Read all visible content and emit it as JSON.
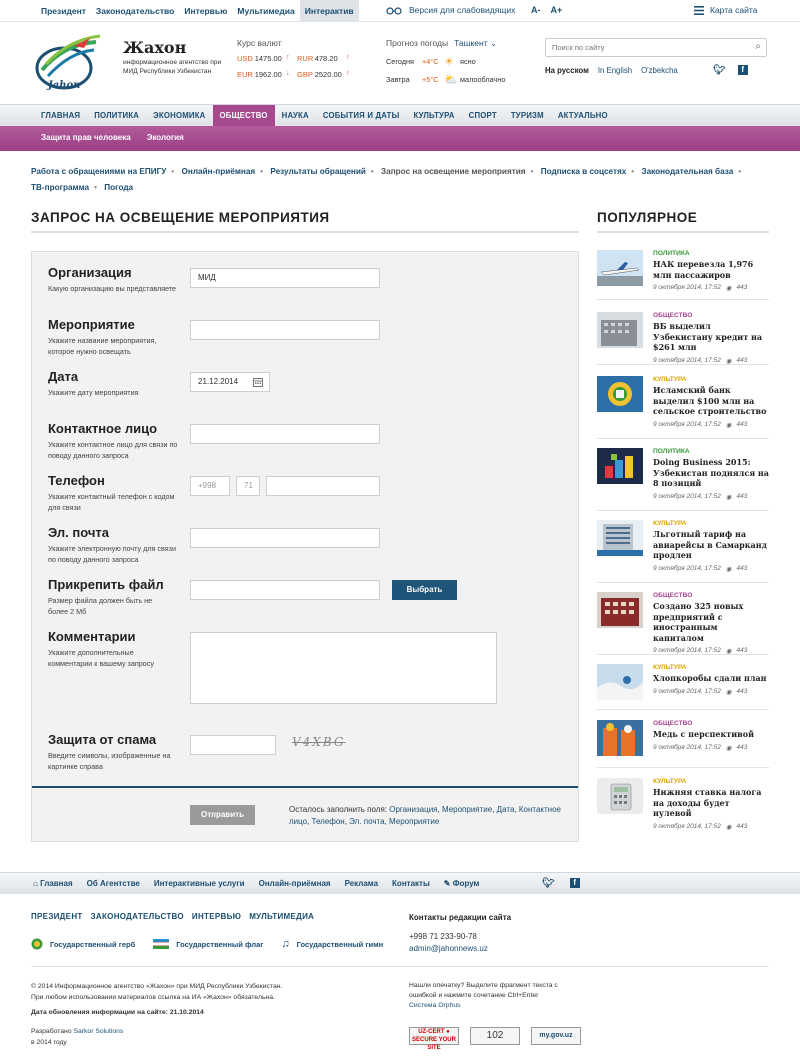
{
  "topbar": {
    "links": [
      "Президент",
      "Законодательство",
      "Интервью",
      "Мультимедиа",
      "Интерактив"
    ],
    "active": "Интерактив",
    "visually_impaired": "Версия для слабовидящих",
    "font_minus": "A-",
    "font_plus": "A+",
    "sitemap": "Карта сайта"
  },
  "header": {
    "title": "Жахон",
    "subtitle": "информационное агентство при МИД Республики Узбекистан",
    "currency_title": "Курс валют",
    "currencies": [
      {
        "code": "USD",
        "value": "1475.00",
        "trend": "up"
      },
      {
        "code": "RUR",
        "value": "478.20",
        "trend": "up"
      },
      {
        "code": "EUR",
        "value": "1962.00",
        "trend": "down"
      },
      {
        "code": "GBP",
        "value": "2520.00",
        "trend": "up"
      }
    ],
    "weather_title": "Прогноз погоды",
    "weather_city": "Ташкент",
    "weather": [
      {
        "day": "Сегодня",
        "temp": "+4°C",
        "desc": "ясно",
        "icon": "sun-icon"
      },
      {
        "day": "Завтра",
        "temp": "+5°C",
        "desc": "малооблачно",
        "icon": "partly-cloudy-icon"
      }
    ],
    "search_placeholder": "Поиск по сайту",
    "languages": [
      {
        "label": "На русском",
        "current": true
      },
      {
        "label": "In English",
        "current": false
      },
      {
        "label": "O'zbekcha",
        "current": false
      }
    ]
  },
  "main_nav": [
    "ГЛАВНАЯ",
    "ПОЛИТИКА",
    "ЭКОНОМИКА",
    "ОБЩЕСТВО",
    "НАУКА",
    "СОБЫТИЯ И ДАТЫ",
    "КУЛЬТУРА",
    "СПОРТ",
    "ТУРИЗМ",
    "АКТУАЛЬНО"
  ],
  "main_nav_active": "ОБЩЕСТВО",
  "sub_nav": [
    "Защита прав человека",
    "Экология"
  ],
  "breadcrumbs": [
    {
      "label": "Работа с обращениями на ЕПИГУ",
      "current": false
    },
    {
      "label": "Онлайн-приёмная",
      "current": false
    },
    {
      "label": "Результаты обращений",
      "current": false
    },
    {
      "label": "Запрос на освещение мероприятия",
      "current": true
    },
    {
      "label": "Подписка в соцсетях",
      "current": false
    },
    {
      "label": "Законодательная база",
      "current": false
    },
    {
      "label": "ТВ-программа",
      "current": false
    },
    {
      "label": "Погода",
      "current": false
    }
  ],
  "page_title": "ЗАПРОС НА ОСВЕЩЕНИЕ МЕРОПРИЯТИЯ",
  "form": {
    "org_label": "Организация",
    "org_hint": "Какую организацию вы представляете",
    "org_value": "МИД",
    "event_label": "Мероприятие",
    "event_hint": "Укажите название мероприятия, которое нужно освещать",
    "event_value": "",
    "date_label": "Дата",
    "date_hint": "Укажите дату мероприятия",
    "date_value": "21.12.2014",
    "contact_label": "Контактное лицо",
    "contact_hint": "Укажите контактное лицо для связи по поводу данного запроса",
    "contact_value": "",
    "phone_label": "Телефон",
    "phone_hint": "Укажите контактный телефон с кодом для связи",
    "phone_country": "+998",
    "phone_code": "71",
    "phone_number": "",
    "email_label": "Эл. почта",
    "email_hint": "Укажите электронную почту для связи по поводу данного запроса",
    "email_value": "",
    "file_label": "Прикрепить файл",
    "file_hint": "Размер файла должен быть не более 2 Мб",
    "file_button": "Выбрать",
    "comment_label": "Комментарии",
    "comment_hint": "Укажите дополнительные комментарии к вашему запросу",
    "spam_label": "Защита от спама",
    "spam_hint": "Введите символы, изображенные на картинке справа",
    "captcha": "V4XBG",
    "submit": "Отправить",
    "remaining_prefix": "Осталось заполнить поля:",
    "remaining_fields": [
      "Организация",
      "Мероприятие",
      "Дата",
      "Контактное лицо",
      "Телефон",
      "Эл. почта",
      "Мероприятие"
    ]
  },
  "popular": {
    "title": "ПОПУЛЯРНОЕ",
    "items": [
      {
        "cat": "ПОЛИТИКА",
        "color": "#3a9a3a",
        "title": "НАК перевезла 1,976 млн пассажиров",
        "date": "9 октября 2014, 17:52",
        "views": "443",
        "thumb": "plane"
      },
      {
        "cat": "ОБЩЕСТВО",
        "color": "#a5488e",
        "title": "ВБ выделил Узбекистану кредит на $261 млн",
        "date": "9 октября 2014, 17:52",
        "views": "443",
        "thumb": "building"
      },
      {
        "cat": "КУЛЬТУРА",
        "color": "#e2a200",
        "title": "Исламский банк выделил $100 млн на сельское строительство",
        "date": "9 октября 2014, 17:52",
        "views": "443",
        "thumb": "emblem"
      },
      {
        "cat": "ПОЛИТИКА",
        "color": "#3a9a3a",
        "title": "Doing Business 2015: Узбекистан поднялся на 8 позиций",
        "date": "9 октября 2014, 17:52",
        "views": "443",
        "thumb": "blocks"
      },
      {
        "cat": "КУЛЬТУРА",
        "color": "#e2a200",
        "title": "Льготный тариф на авиарейсы в Самарканд продлен",
        "date": "9 октября 2014, 17:52",
        "views": "443",
        "thumb": "hotel"
      },
      {
        "cat": "ОБЩЕСТВО",
        "color": "#a5488e",
        "title": "Создано 325 новых предприятий с иностранным капиталом",
        "date": "9 октября 2014, 17:52",
        "views": "443",
        "thumb": "red-building"
      },
      {
        "cat": "КУЛЬТУРА",
        "color": "#e2a200",
        "title": "Хлопкоробы сдали план",
        "date": "9 октября 2014, 17:52",
        "views": "443",
        "thumb": "cotton"
      },
      {
        "cat": "ОБЩЕСТВО",
        "color": "#a5488e",
        "title": "Медь с перспективой",
        "date": "9 октября 2014, 17:52",
        "views": "443",
        "thumb": "workers"
      },
      {
        "cat": "КУЛЬТУРА",
        "color": "#e2a200",
        "title": "Нижняя ставка налога на доходы будет нулевой",
        "date": "9 октября 2014, 17:52",
        "views": "443",
        "thumb": "calculator"
      }
    ]
  },
  "footer": {
    "nav": [
      "Главная",
      "Об Агентстве",
      "Интерактивные услуги",
      "Онлайн-приёмная",
      "Реклама",
      "Контакты",
      "Форум"
    ],
    "links": [
      "ПРЕЗИДЕНТ",
      "ЗАКОНОДАТЕЛЬСТВО",
      "ИНТЕРВЬЮ",
      "МУЛЬТИМЕДИА"
    ],
    "symbols": [
      "Государственный герб",
      "Государственный флаг",
      "Государственный гимн"
    ],
    "contacts_title": "Контакты редакции сайта",
    "phone": "+998 71 233-90-78",
    "email": "admin@jahonnews.uz",
    "copyright": "© 2014  Информационное агентство «Жахон» при МИД Республики Узбекистан.",
    "copyright2": "При любом использовании материалов ссылка на ИА «Жахон» обязательна.",
    "updated": "Дата обновления информации на сайте: 21.10.2014",
    "developed_by": "Разработано",
    "developer": "Sarkor Solutions",
    "year": "в 2014 году",
    "typo": "Нашли опечатку? Выделите фрагмент текста с ошибкой и нажмите сочетание Ctrl+Enter",
    "orphus": "Система Orphus",
    "badges": [
      "UZ-CERT ● SECURE YOUR SITE",
      "102",
      "my.gov.uz"
    ]
  }
}
